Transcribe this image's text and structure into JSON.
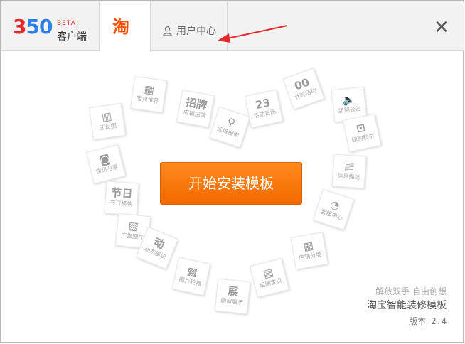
{
  "window": {
    "background": "#ffffff",
    "border": "#b9b9b9"
  },
  "header": {
    "logo": {
      "digits": [
        "3",
        "5",
        "0"
      ],
      "beta": "BETA!",
      "subtitle": "客户端"
    },
    "taobao_tab": {
      "glyph": "淘",
      "color": "#ff5000",
      "selected": true
    },
    "user_tab": {
      "icon": "user-icon",
      "label": "用户中心"
    },
    "close": {
      "icon": "close-icon",
      "glyph": "✕"
    },
    "annotation": {
      "icon": "red-arrow-icon",
      "color": "#e8292b"
    }
  },
  "main": {
    "start_button": {
      "label": "开始安装模板",
      "color": "#f5780c"
    },
    "tiles": [
      {
        "icon": "▦",
        "label": "宝贝推荐"
      },
      {
        "icon": "招牌",
        "label": "店铺招牌"
      },
      {
        "icon": "▥",
        "label": "正反图"
      },
      {
        "icon": "⚲",
        "label": "区域搜索"
      },
      {
        "icon": "23",
        "label": "活动日历"
      },
      {
        "icon": "00",
        "label": "计时活动"
      },
      {
        "icon": "🔈",
        "label": "店铺公告"
      },
      {
        "icon": "◙",
        "label": "宝贝分享"
      },
      {
        "icon": "⊡",
        "label": "团购秒杀"
      },
      {
        "icon": "节日",
        "label": "节日模块"
      },
      {
        "icon": "▤",
        "label": "信息描述"
      },
      {
        "icon": "▧",
        "label": "广告图片"
      },
      {
        "icon": "◔",
        "label": "客服中心"
      },
      {
        "icon": "动",
        "label": "动态模块"
      },
      {
        "icon": "▦",
        "label": "店铺分类"
      },
      {
        "icon": "▩",
        "label": "图片轮播"
      },
      {
        "icon": "▤",
        "label": "组图宝贝"
      },
      {
        "icon": "展",
        "label": "橱窗展示"
      }
    ],
    "slogan": "解放双手 自由创想",
    "product_name": "淘宝智能装修模板",
    "version": "版本 2.4"
  }
}
